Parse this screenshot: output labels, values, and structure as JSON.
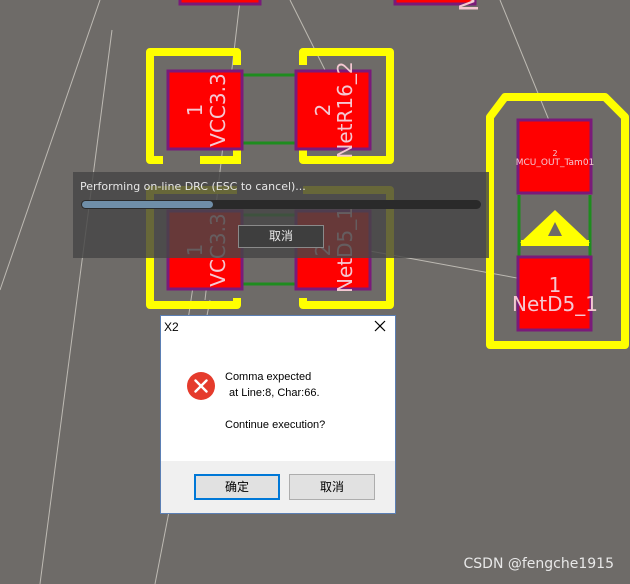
{
  "pcb": {
    "pads": [
      {
        "id": "p1",
        "number": "1",
        "net": "VCC3.3"
      },
      {
        "id": "p2",
        "number": "2",
        "net": "NetR16_2"
      },
      {
        "id": "p3",
        "number": "1",
        "net": "VCC3.3"
      },
      {
        "id": "p4",
        "number": "2",
        "net": "NetD5_1"
      },
      {
        "id": "p5",
        "number": "2",
        "net": "MCU_OUT_Tam01"
      },
      {
        "id": "p6",
        "number": "1",
        "net": "NetD5_1"
      }
    ],
    "top_partial_label": "M",
    "colors": {
      "background": "#6e6b68",
      "silkscreen": "#ffff00",
      "pad": "#ff0000",
      "pad_border": "#7a1a7a",
      "trace": "#1e8c1e",
      "pad_text": "#f4c8d2"
    }
  },
  "drc": {
    "status_text": "Performing on-line DRC (ESC to cancel)...",
    "progress": 0.33,
    "cancel_label": "取消"
  },
  "dialog": {
    "title": "X2",
    "icon": "error-icon",
    "message_line1": "Comma expected",
    "message_line2": "at Line:8, Char:66.",
    "message_line3": "Continue execution?",
    "ok_label": "确定",
    "cancel_label": "取消"
  },
  "watermark": "CSDN @fengche1915"
}
